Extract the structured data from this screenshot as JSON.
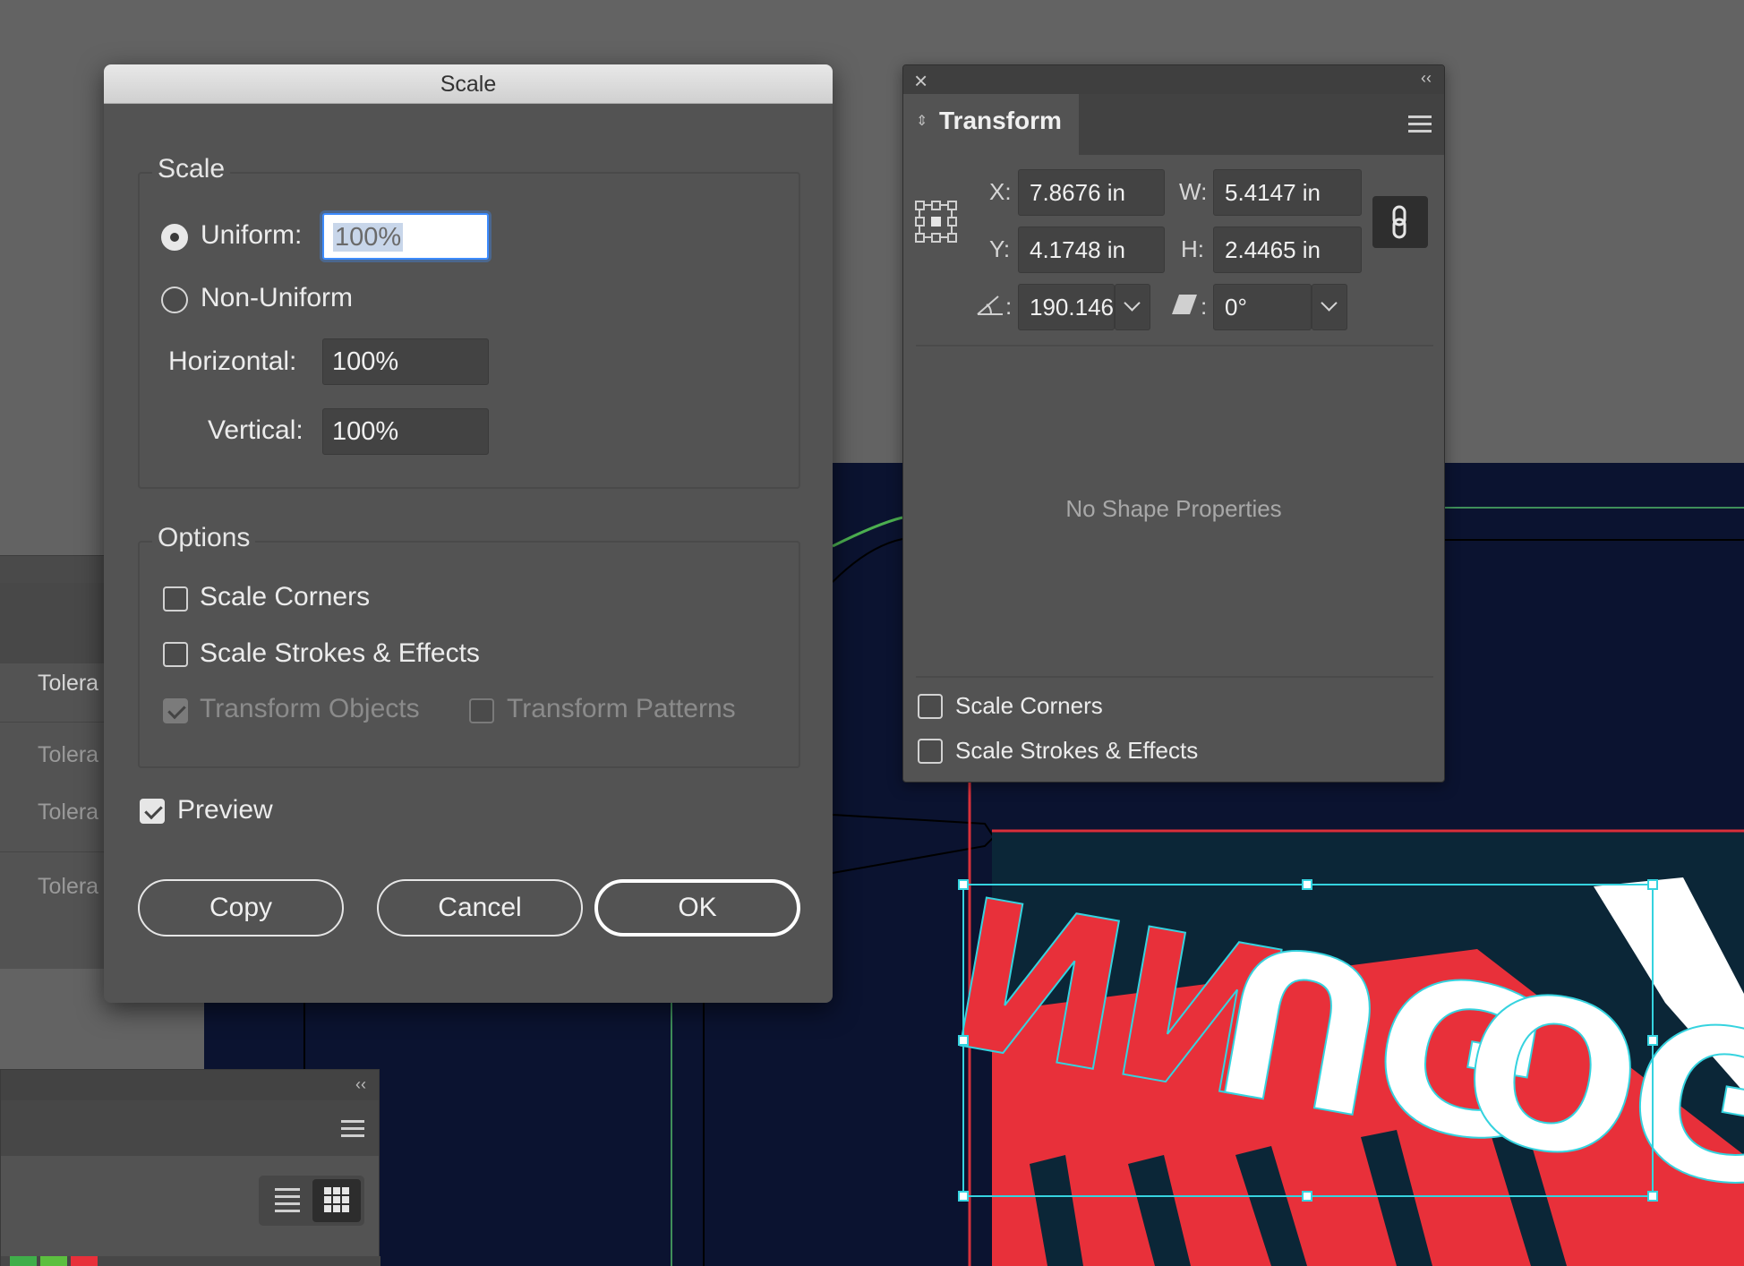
{
  "scale_dialog": {
    "title": "Scale",
    "scale_group_label": "Scale",
    "uniform_label": "Uniform:",
    "uniform_value": "100%",
    "uniform_selected": true,
    "non_uniform_label": "Non-Uniform",
    "horizontal_label": "Horizontal:",
    "horizontal_value": "100%",
    "vertical_label": "Vertical:",
    "vertical_value": "100%",
    "options_group_label": "Options",
    "scale_corners_label": "Scale Corners",
    "scale_strokes_label": "Scale Strokes & Effects",
    "transform_objects_label": "Transform Objects",
    "transform_patterns_label": "Transform Patterns",
    "preview_label": "Preview",
    "copy_button": "Copy",
    "cancel_button": "Cancel",
    "ok_button": "OK"
  },
  "transform_panel": {
    "tab_label": "Transform",
    "x_label": "X:",
    "x_value": "7.8676 in",
    "y_label": "Y:",
    "y_value": "4.1748 in",
    "w_label": "W:",
    "w_value": "5.4147 in",
    "h_label": "H:",
    "h_value": "2.4465 in",
    "rotate_value": "190.146°",
    "shear_value": "0°",
    "colon": ":",
    "no_shape_text": "No Shape Properties",
    "scale_corners_label": "Scale Corners",
    "scale_strokes_label": "Scale Strokes & Effects"
  },
  "background_panel": {
    "rows": [
      "Tolera",
      "Tolera",
      "Tolera",
      "Tolera"
    ]
  },
  "colors": {
    "accent_blue": "#3d8bfd",
    "artwork_red": "#e8303a",
    "selection_cyan": "#35d3df",
    "canvas_navy": "#0b1330"
  },
  "icons": {
    "close": "close-icon",
    "collapse": "double-chevron-left-icon",
    "menu": "hamburger-menu-icon",
    "reference_point": "reference-point-icon",
    "constrain": "link-icon",
    "rotate": "rotate-angle-icon",
    "shear": "shear-icon",
    "list_view": "list-view-icon",
    "grid_view": "grid-view-icon"
  }
}
